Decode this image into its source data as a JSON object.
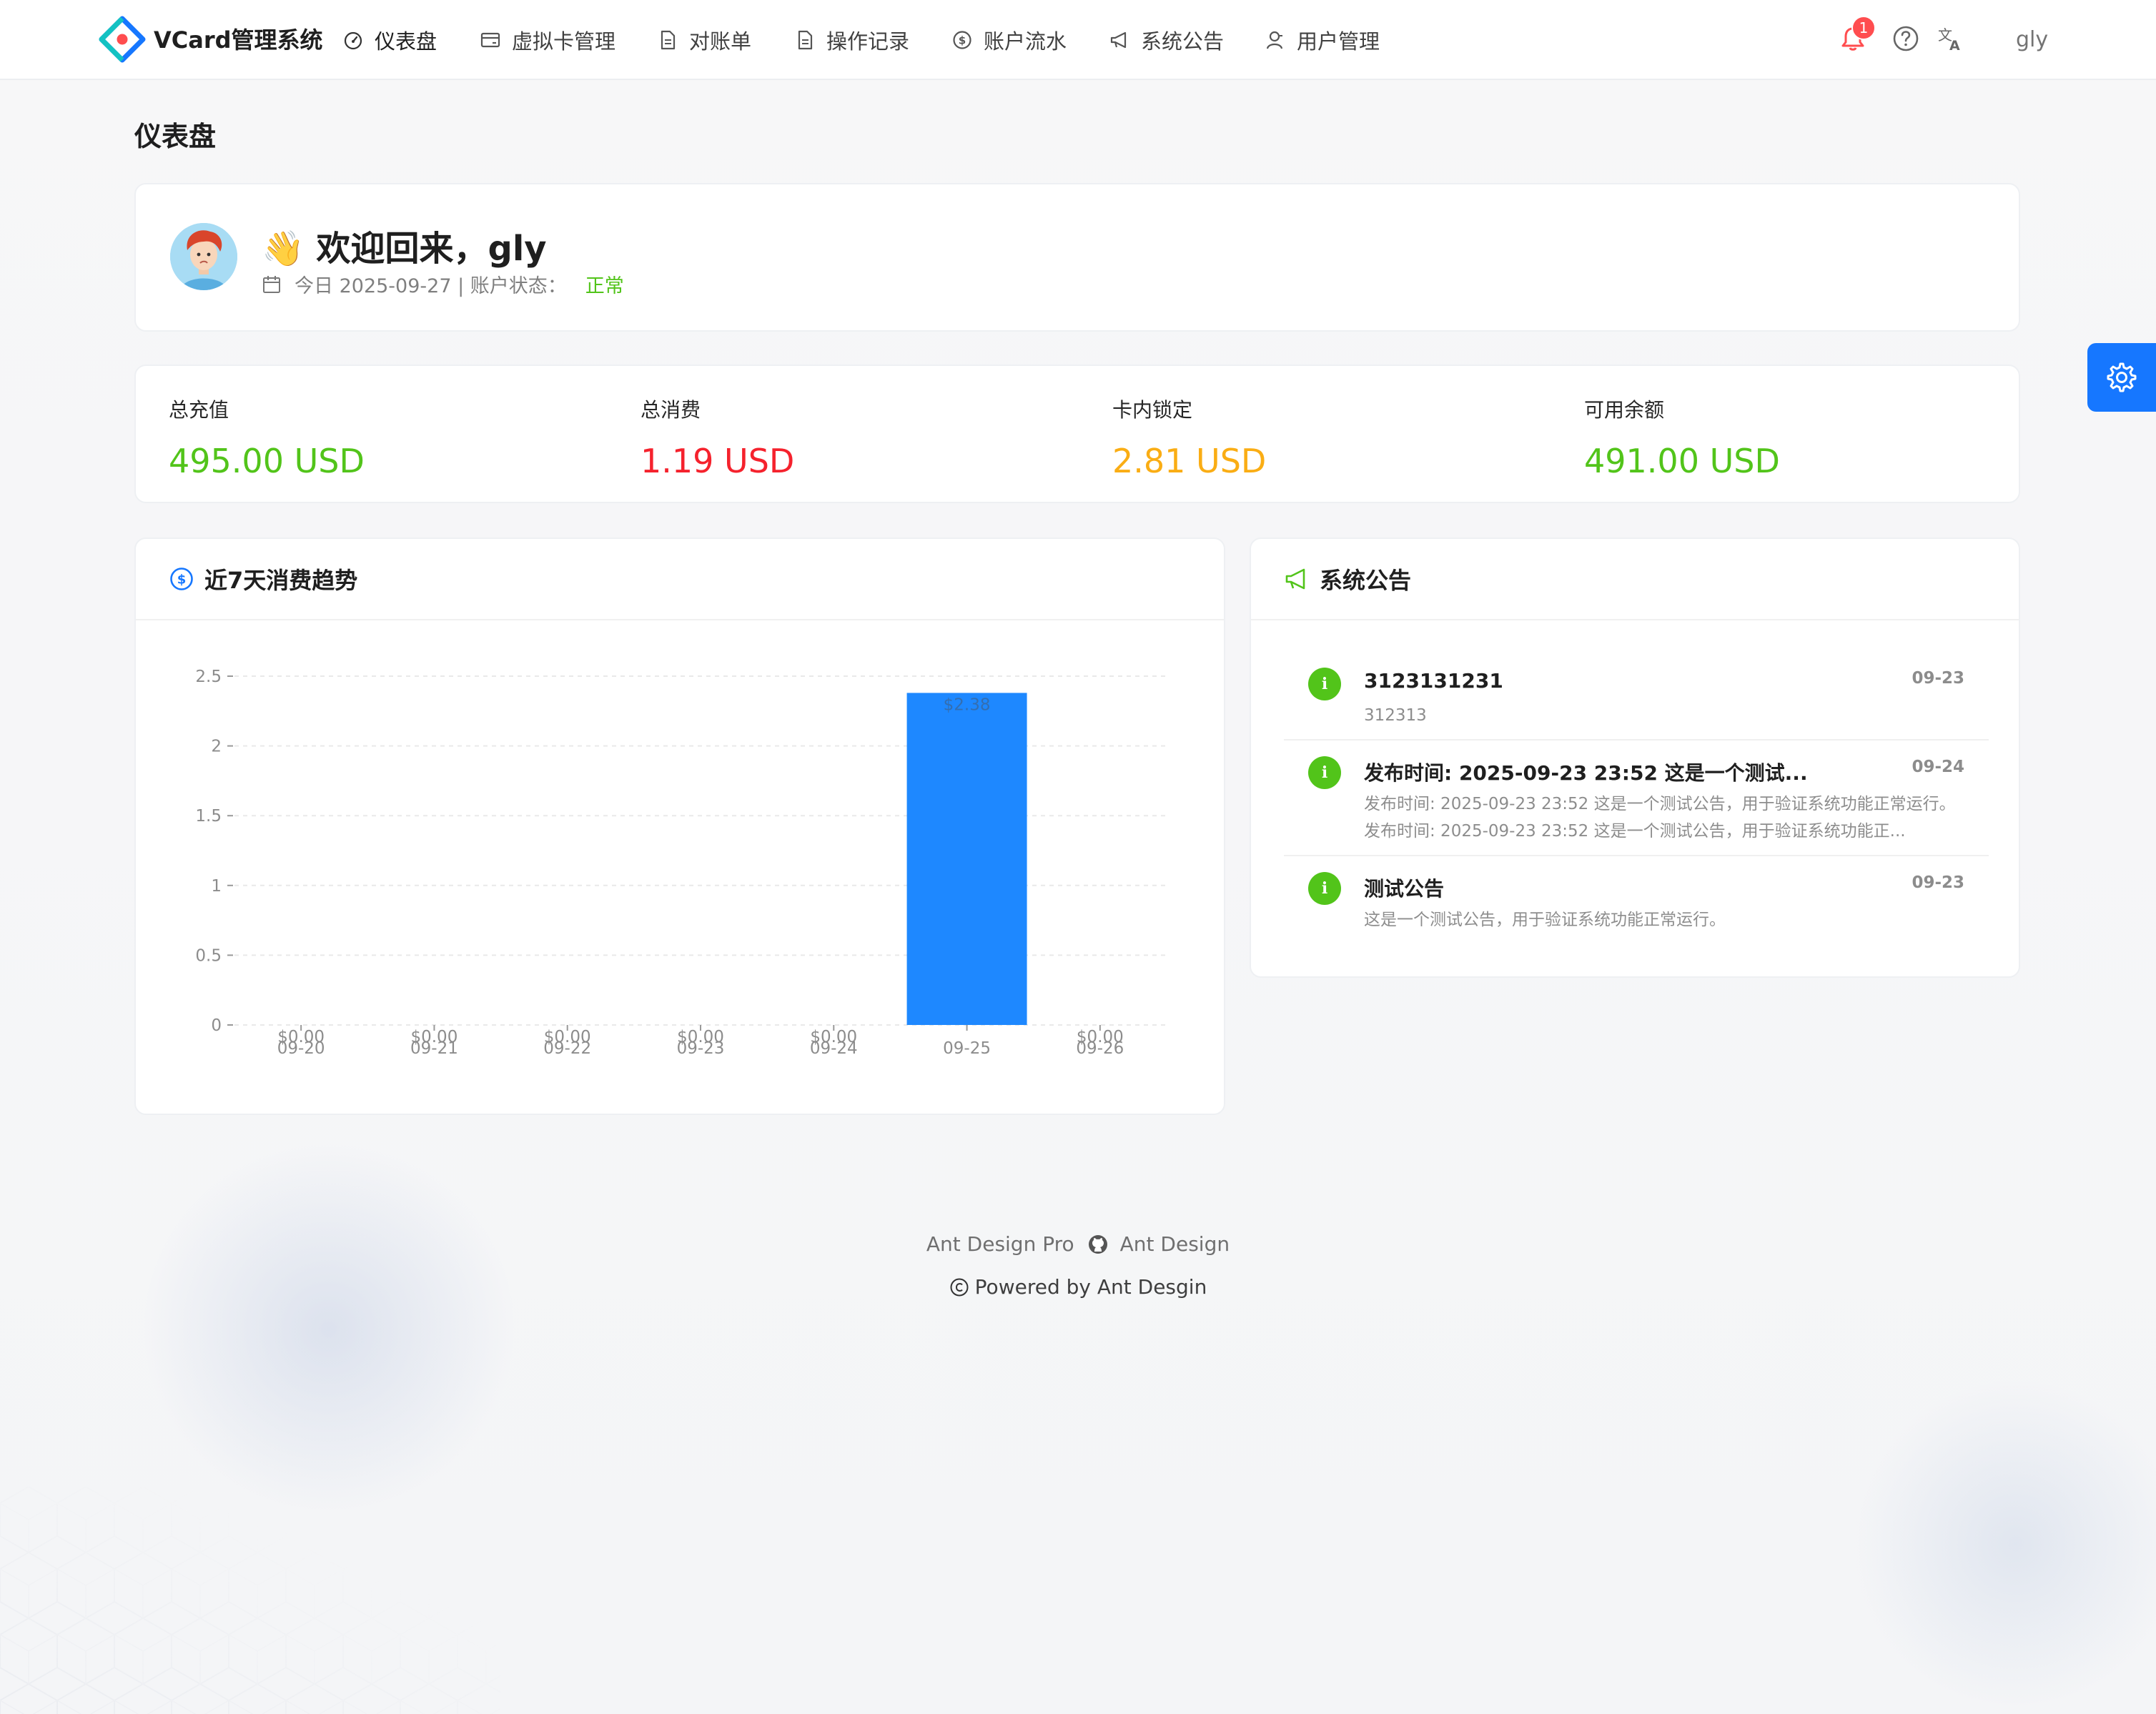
{
  "app": {
    "title": "VCard管理系统",
    "logo_icon": "vcard-logo-icon"
  },
  "nav": {
    "items": [
      {
        "label": "仪表盘",
        "icon": "dashboard-icon",
        "active": true
      },
      {
        "label": "虚拟卡管理",
        "icon": "credit-card-icon"
      },
      {
        "label": "对账单",
        "icon": "file-text-icon"
      },
      {
        "label": "操作记录",
        "icon": "file-text-icon"
      },
      {
        "label": "账户流水",
        "icon": "dollar-icon"
      },
      {
        "label": "系统公告",
        "icon": "notification-icon"
      },
      {
        "label": "用户管理",
        "icon": "user-icon"
      }
    ]
  },
  "header": {
    "notification_count": "1",
    "user_name": "gly"
  },
  "page": {
    "title": "仪表盘"
  },
  "welcome": {
    "greeting": "👋 欢迎回来，gly",
    "date_text": "今日 2025-09-27 | 账户状态：",
    "status": "正常"
  },
  "stats": [
    {
      "label": "总充值",
      "value": "495.00 USD",
      "color": "#52c41a"
    },
    {
      "label": "总消费",
      "value": "1.19 USD",
      "color": "#f5222d"
    },
    {
      "label": "卡内锁定",
      "value": "2.81 USD",
      "color": "#faad14"
    },
    {
      "label": "可用余额",
      "value": "491.00 USD",
      "color": "#52c41a"
    }
  ],
  "trend": {
    "title": "近7天消费趋势"
  },
  "chart_data": {
    "type": "bar",
    "categories": [
      "09-20",
      "09-21",
      "09-22",
      "09-23",
      "09-24",
      "09-25",
      "09-26"
    ],
    "values": [
      0,
      0,
      0,
      0,
      0,
      2.38,
      0
    ],
    "data_labels": [
      "$0.00",
      "$0.00",
      "$0.00",
      "$0.00",
      "$0.00",
      "$2.38",
      "$0.00"
    ],
    "yticks": [
      "0",
      "0.5",
      "1",
      "1.5",
      "2",
      "2.5"
    ],
    "ylim": [
      0,
      2.5
    ],
    "bar_color": "#1e88ff",
    "grid": true
  },
  "notices": {
    "title": "系统公告",
    "items": [
      {
        "title": "3123131231",
        "date": "09-23",
        "desc": "312313"
      },
      {
        "title": "发布时间: 2025-09-23 23:52 这是一个测试...",
        "date": "09-24",
        "desc": "发布时间: 2025-09-23 23:52 这是一个测试公告，用于验证系统功能正常运行。发布时间: 2025-09-23 23:52 这是一个测试公告，用于验证系统功能正..."
      },
      {
        "title": "测试公告",
        "date": "09-23",
        "desc": "这是一个测试公告，用于验证系统功能正常运行。"
      }
    ]
  },
  "footer": {
    "link_pro": "Ant Design Pro",
    "link_ant": "Ant Design",
    "copyright": "Powered by Ant Desgin"
  }
}
